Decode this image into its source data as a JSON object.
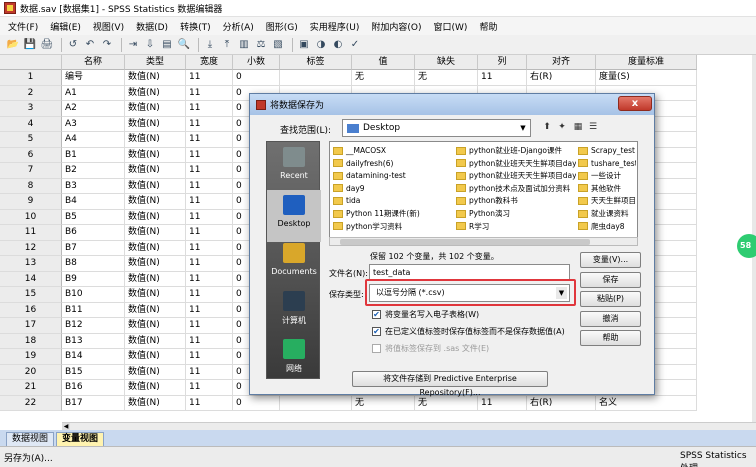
{
  "window": {
    "title": "数据.sav [数据集1] - SPSS Statistics 数据编辑器"
  },
  "menu": [
    "文件(F)",
    "编辑(E)",
    "视图(V)",
    "数据(D)",
    "转换(T)",
    "分析(A)",
    "图形(G)",
    "实用程序(U)",
    "附加内容(O)",
    "窗口(W)",
    "帮助"
  ],
  "toolbar_icons": [
    "open-icon",
    "save-icon",
    "print-icon",
    "dialog-recall-icon",
    "undo-icon",
    "redo-icon",
    "goto-case-icon",
    "goto-variable-icon",
    "variables-icon",
    "find-icon",
    "insert-cases-icon",
    "insert-variable-icon",
    "split-file-icon",
    "weight-cases-icon",
    "select-cases-icon",
    "value-labels-icon",
    "use-sets-icon",
    "show-all-icon",
    "spell-check-icon"
  ],
  "grid": {
    "headers": [
      "",
      "名称",
      "类型",
      "宽度",
      "小数",
      "标签",
      "值",
      "缺失",
      "列",
      "对齐",
      "度量标准"
    ],
    "rows": [
      [
        "1",
        "编号",
        "数值(N)",
        "11",
        "0",
        "",
        "无",
        "无",
        "11",
        "右(R)",
        "度量(S)"
      ],
      [
        "2",
        "A1",
        "数值(N)",
        "11",
        "0",
        "",
        "",
        "",
        "",
        "",
        ""
      ],
      [
        "3",
        "A2",
        "数值(N)",
        "11",
        "0",
        "",
        "",
        "",
        "",
        "",
        ""
      ],
      [
        "4",
        "A3",
        "数值(N)",
        "11",
        "0",
        "",
        "",
        "",
        "",
        "",
        ""
      ],
      [
        "5",
        "A4",
        "数值(N)",
        "11",
        "0",
        "",
        "",
        "",
        "",
        "",
        ""
      ],
      [
        "6",
        "B1",
        "数值(N)",
        "11",
        "0",
        "",
        "",
        "",
        "",
        "",
        ""
      ],
      [
        "7",
        "B2",
        "数值(N)",
        "11",
        "0",
        "",
        "",
        "",
        "",
        "",
        ""
      ],
      [
        "8",
        "B3",
        "数值(N)",
        "11",
        "0",
        "",
        "",
        "",
        "",
        "",
        ""
      ],
      [
        "9",
        "B4",
        "数值(N)",
        "11",
        "0",
        "",
        "",
        "",
        "",
        "",
        ""
      ],
      [
        "10",
        "B5",
        "数值(N)",
        "11",
        "0",
        "",
        "",
        "",
        "",
        "",
        ""
      ],
      [
        "11",
        "B6",
        "数值(N)",
        "11",
        "0",
        "",
        "",
        "",
        "",
        "",
        ""
      ],
      [
        "12",
        "B7",
        "数值(N)",
        "11",
        "0",
        "",
        "",
        "",
        "",
        "",
        ""
      ],
      [
        "13",
        "B8",
        "数值(N)",
        "11",
        "0",
        "",
        "",
        "",
        "",
        "",
        ""
      ],
      [
        "14",
        "B9",
        "数值(N)",
        "11",
        "0",
        "",
        "",
        "",
        "",
        "",
        ""
      ],
      [
        "15",
        "B10",
        "数值(N)",
        "11",
        "0",
        "",
        "",
        "",
        "",
        "",
        ""
      ],
      [
        "16",
        "B11",
        "数值(N)",
        "11",
        "0",
        "",
        "",
        "",
        "",
        "",
        ""
      ],
      [
        "17",
        "B12",
        "数值(N)",
        "11",
        "0",
        "",
        "",
        "",
        "",
        "",
        ""
      ],
      [
        "18",
        "B13",
        "数值(N)",
        "11",
        "0",
        "",
        "",
        "",
        "",
        "",
        ""
      ],
      [
        "19",
        "B14",
        "数值(N)",
        "11",
        "0",
        "",
        "",
        "",
        "",
        "",
        ""
      ],
      [
        "20",
        "B15",
        "数值(N)",
        "11",
        "0",
        "",
        "",
        "",
        "",
        "",
        ""
      ],
      [
        "21",
        "B16",
        "数值(N)",
        "11",
        "0",
        "",
        "无",
        "无",
        "11",
        "右(R)",
        "名义"
      ],
      [
        "22",
        "B17",
        "数值(N)",
        "11",
        "0",
        "",
        "无",
        "无",
        "11",
        "右(R)",
        "名义"
      ]
    ]
  },
  "tabs": [
    "数据视图",
    "变量视图"
  ],
  "status": {
    "left": "另存为(A)...",
    "right": "SPSS Statistics 处理"
  },
  "side_badge": "58",
  "dialog": {
    "title": "将数据保存为",
    "close": "x",
    "lookin_label": "查找范围(L):",
    "lookin_value": "Desktop",
    "places": [
      "Recent",
      "Desktop",
      "Documents",
      "计算机",
      "网络"
    ],
    "files": [
      "__MACOSX",
      "dailyfresh(6)",
      "datamining-test",
      "day9",
      "tida",
      "Python 11期课件(新)",
      "python学习资料",
      "python就业班-Django课件",
      "python就业班天天生鲜项目day8",
      "python就业班天天生鲜项目day7",
      "python技术点及面试加分资料",
      "python教科书",
      "Python演习",
      "R学习",
      "Scrapy_test",
      "tushare_test",
      "一些设计",
      "其他软件",
      "天天生鲜项目资料",
      "就业课资料",
      "爬虫day8"
    ],
    "var_info": "保留 102 个变量，共 102 个变量。",
    "filename_label": "文件名(N):",
    "filename": "test_data",
    "filetype_label": "保存类型:",
    "filetype": "以逗号分隔 (*.csv)",
    "checks": [
      {
        "label": "将变量名写入电子表格(W)",
        "checked": true,
        "disabled": false
      },
      {
        "label": "在已定义值标签时保存值标签而不是保存数据值(A)",
        "checked": true,
        "disabled": false
      },
      {
        "label": "将值标签保存到 .sas 文件(E)",
        "checked": false,
        "disabled": true
      }
    ],
    "buttons": [
      "变量(V)...",
      "保存",
      "粘贴(P)",
      "撤消",
      "帮助"
    ],
    "repo_button": "将文件存储到 Predictive Enterprise Repository(F)..."
  }
}
